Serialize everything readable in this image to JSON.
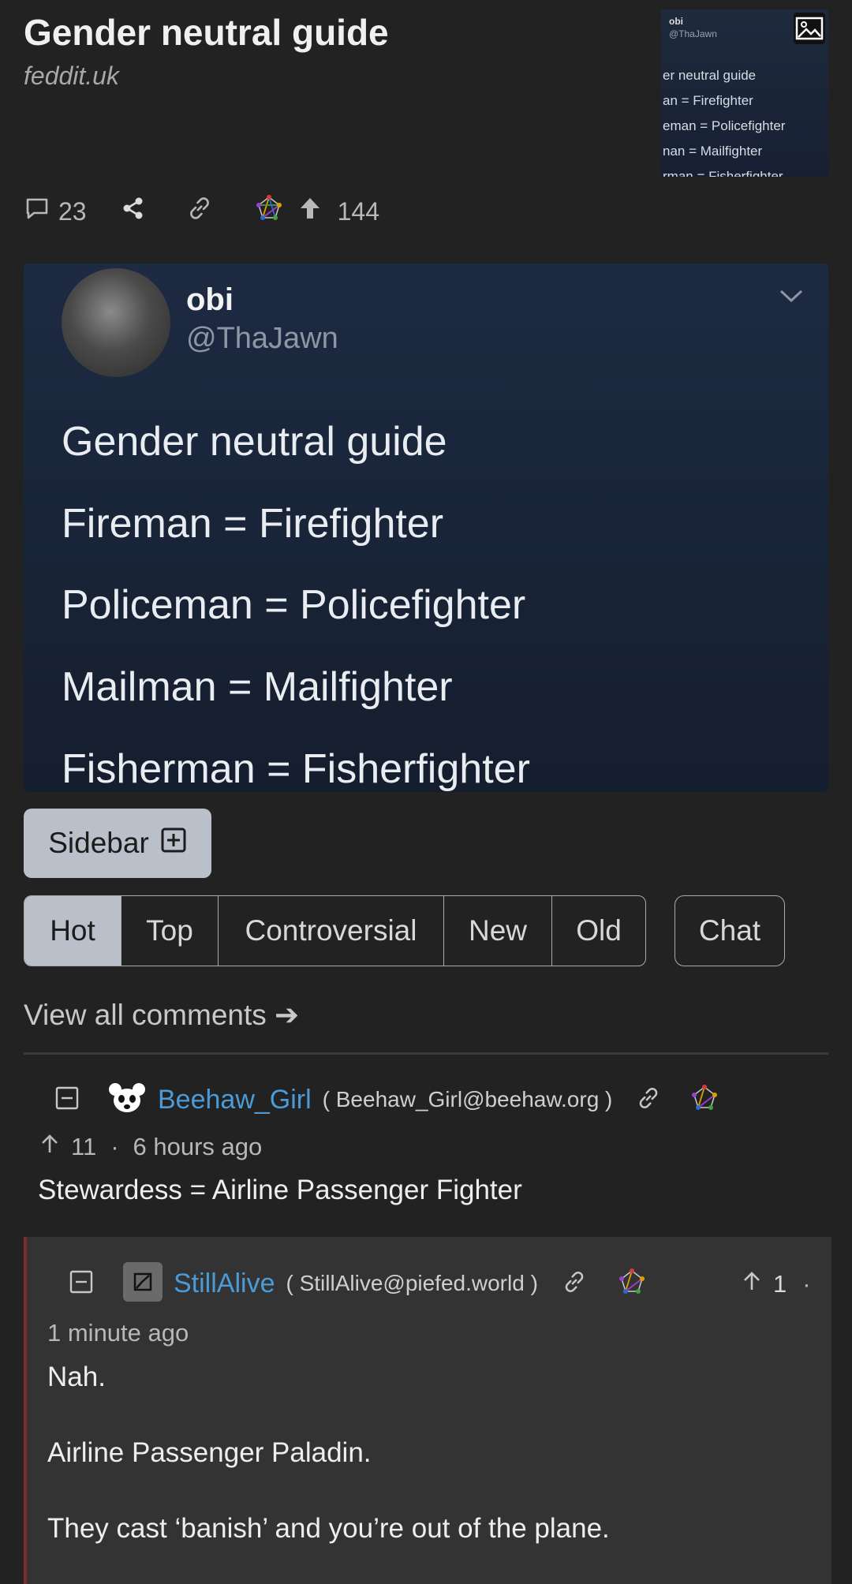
{
  "post": {
    "title": "Gender neutral guide",
    "domain": "feddit.uk",
    "comment_count": "23",
    "upvotes": "144"
  },
  "thumbnail": {
    "user": "obi",
    "handle": "@ThaJawn",
    "lines": [
      "er neutral guide",
      "an = Firefighter",
      "eman = Policefighter",
      "nan = Mailfighter",
      "rman = Fisherfighter"
    ]
  },
  "meme": {
    "user": "obi",
    "handle": "@ThaJawn",
    "lines": [
      "Gender neutral guide",
      "Fireman = Firefighter",
      "Policeman = Policefighter",
      "Mailman = Mailfighter",
      "Fisherman = Fisherfighter"
    ]
  },
  "sidebar_label": "Sidebar",
  "sort_tabs": [
    {
      "label": "Hot",
      "active": true
    },
    {
      "label": "Top"
    },
    {
      "label": "Controversial"
    },
    {
      "label": "New"
    },
    {
      "label": "Old"
    }
  ],
  "chat_label": "Chat",
  "view_all_label": "View all comments ➔",
  "comments": [
    {
      "user": "Beehaw_Girl",
      "instance": "( Beehaw_Girl@beehaw.org )",
      "score": "11",
      "separator": "·",
      "time": "6 hours ago",
      "body": "Stewardess = Airline Passenger Fighter"
    },
    {
      "user": "StillAlive",
      "instance": "( StillAlive@piefed.world )",
      "score": "1",
      "separator": "·",
      "time": "1 minute ago",
      "body_lines": [
        "Nah.",
        "Airline Passenger Paladin.",
        "They cast ‘banish’ and you’re out of the plane."
      ]
    }
  ],
  "colors": {
    "background": "#222222",
    "link_blue": "#4b9bd8",
    "active_tab": "#b9c0ca",
    "reply_bg": "#333333",
    "reply_border": "#7a2e2e"
  },
  "icons": [
    "comment-icon",
    "share-icon",
    "link-icon",
    "fediverse-icon",
    "upvote-arrow-icon",
    "image-icon",
    "chevron-down-icon",
    "plus-square-icon",
    "collapse-icon"
  ]
}
